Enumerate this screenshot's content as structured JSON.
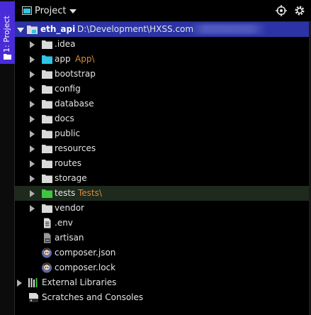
{
  "stripe": {
    "label": "1: Project"
  },
  "header": {
    "title": "Project"
  },
  "colors": {
    "accent": "#2c33a6",
    "folder": "#dadada",
    "source_folder": "#2fc6e6",
    "test_folder": "#3fc63f",
    "marker": "#d98b3a"
  },
  "tree": {
    "root": {
      "name": "eth_api",
      "path": "D:\\Development\\HXSS.com"
    },
    "items": [
      {
        "name": ".idea",
        "kind": "folder",
        "icon": "folder-icon"
      },
      {
        "name": "app",
        "kind": "source-folder",
        "icon": "source-folder-icon",
        "marker": "App\\"
      },
      {
        "name": "bootstrap",
        "kind": "folder",
        "icon": "folder-icon"
      },
      {
        "name": "config",
        "kind": "folder",
        "icon": "folder-icon"
      },
      {
        "name": "database",
        "kind": "folder",
        "icon": "folder-icon"
      },
      {
        "name": "docs",
        "kind": "folder",
        "icon": "folder-icon"
      },
      {
        "name": "public",
        "kind": "folder",
        "icon": "folder-icon"
      },
      {
        "name": "resources",
        "kind": "folder",
        "icon": "folder-icon"
      },
      {
        "name": "routes",
        "kind": "folder",
        "icon": "folder-icon"
      },
      {
        "name": "storage",
        "kind": "folder",
        "icon": "folder-icon"
      },
      {
        "name": "tests",
        "kind": "test-folder",
        "icon": "test-folder-icon",
        "marker": "Tests\\"
      },
      {
        "name": "vendor",
        "kind": "folder",
        "icon": "folder-icon"
      },
      {
        "name": ".env",
        "kind": "file",
        "icon": "text-file-icon"
      },
      {
        "name": "artisan",
        "kind": "file",
        "icon": "script-file-icon"
      },
      {
        "name": "composer.json",
        "kind": "file",
        "icon": "composer-icon"
      },
      {
        "name": "composer.lock",
        "kind": "file",
        "icon": "composer-icon"
      }
    ],
    "external_libraries": "External Libraries",
    "scratches": "Scratches and Consoles"
  }
}
